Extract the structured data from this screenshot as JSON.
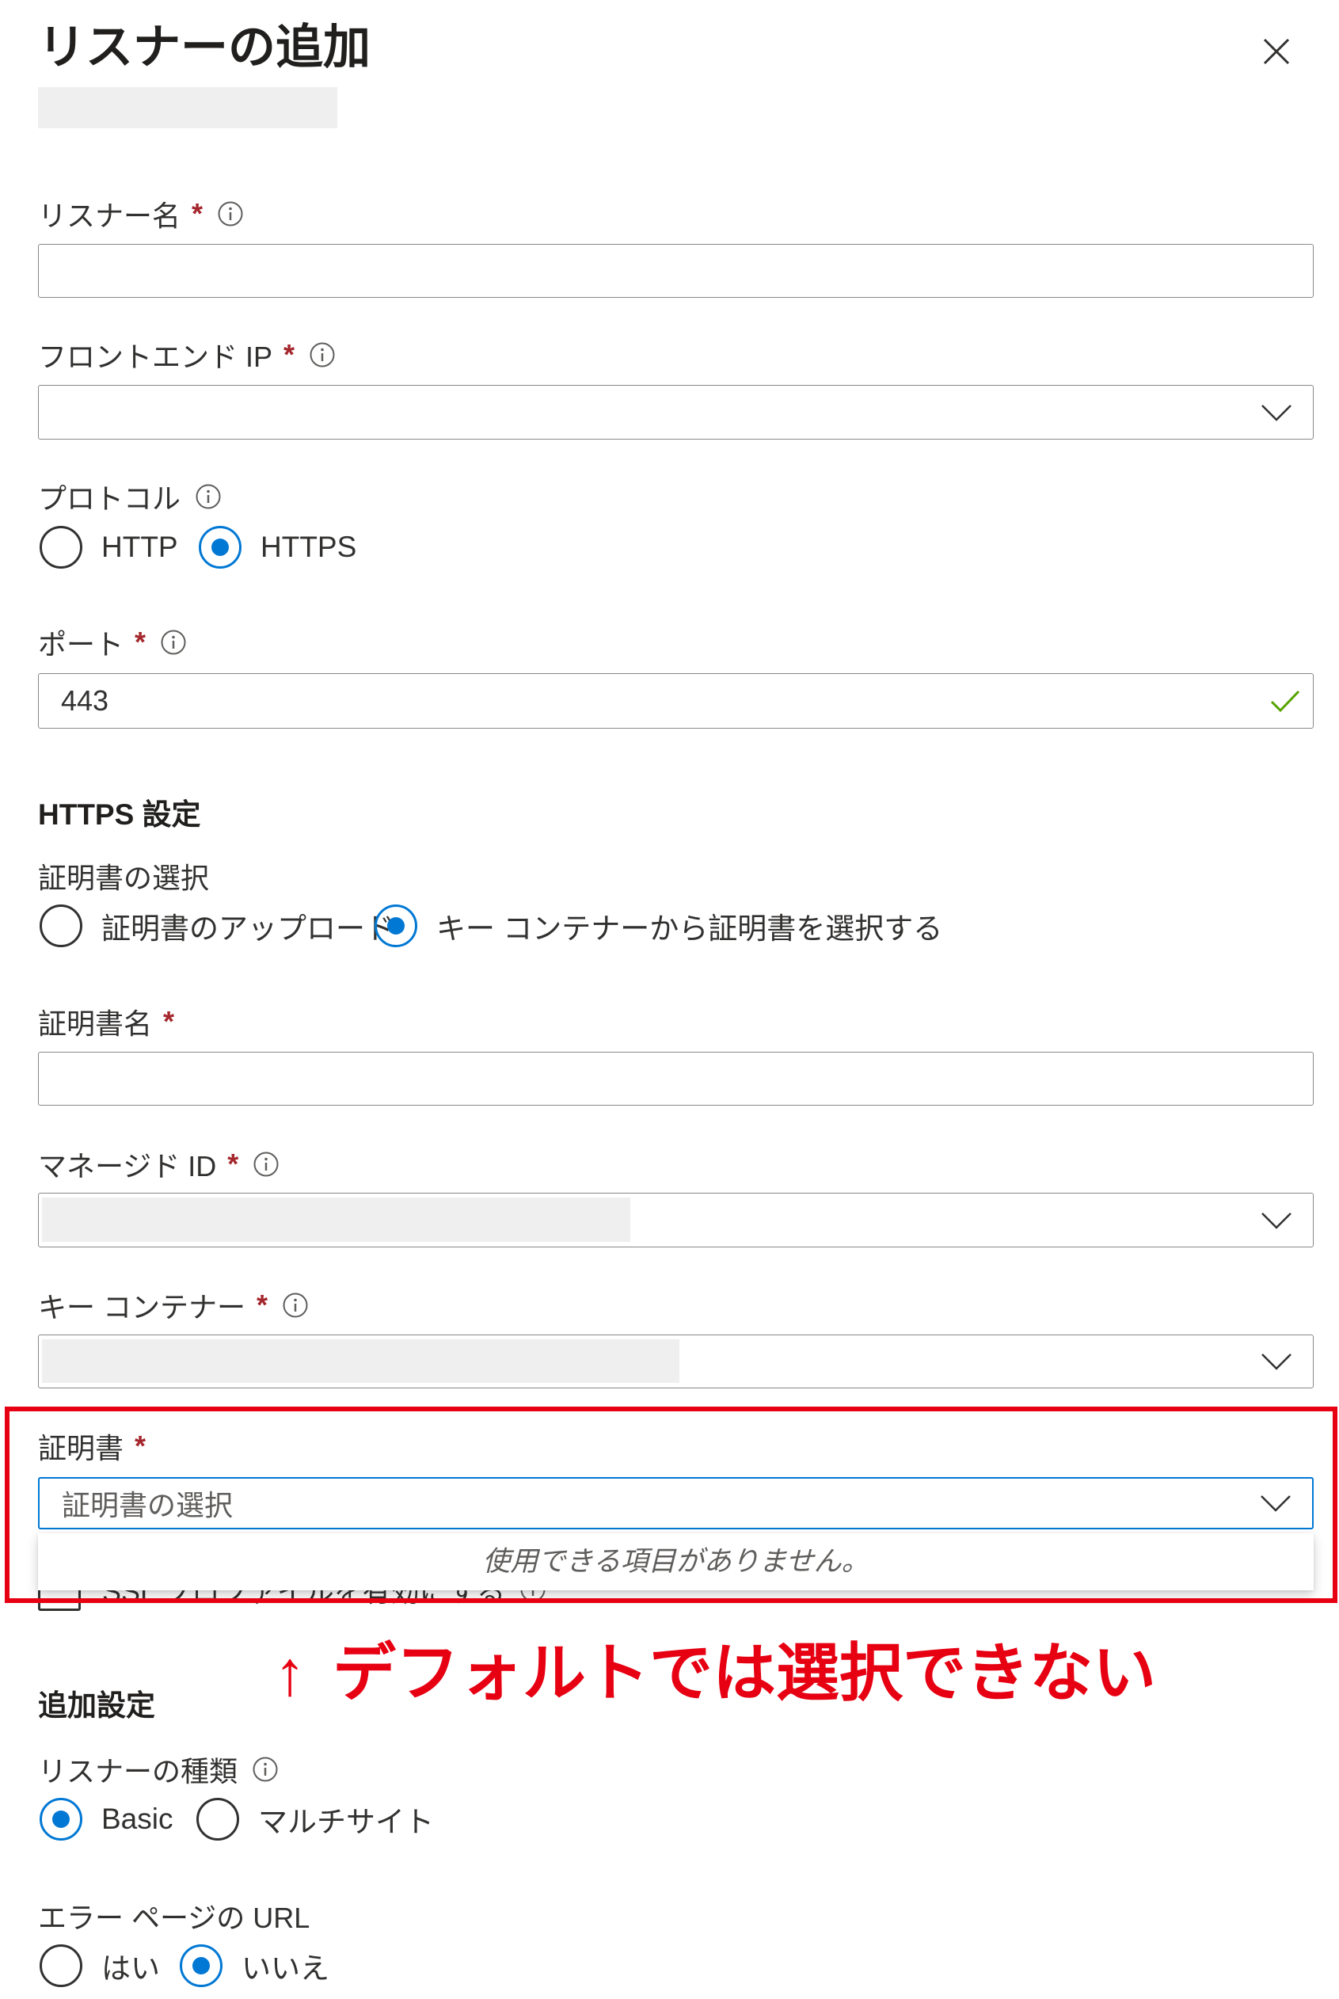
{
  "panel": {
    "title": "リスナーの追加"
  },
  "icons": {
    "close": "close-icon",
    "info": "info-icon",
    "chevron": "chevron-down-icon",
    "check": "checkmark-icon",
    "arrow": "up-arrow"
  },
  "colors": {
    "accent": "#0078d4",
    "required": "#a4262c",
    "valid_check": "#57a300",
    "annotation": "#e60012",
    "text": "#323130"
  },
  "required_mark": "*",
  "basic": {
    "listener_name": {
      "label": "リスナー名",
      "value": ""
    },
    "frontend_ip": {
      "label": "フロントエンド IP",
      "value": ""
    },
    "protocol": {
      "label": "プロトコル",
      "options": [
        "HTTP",
        "HTTPS"
      ],
      "selected": "HTTPS"
    },
    "port": {
      "label": "ポート",
      "value": "443"
    }
  },
  "https_settings": {
    "heading": "HTTPS 設定",
    "certificate_source": {
      "label": "証明書の選択",
      "options": [
        "証明書のアップロード",
        "キー コンテナーから証明書を選択する"
      ],
      "selected": "キー コンテナーから証明書を選択する"
    },
    "certificate_name": {
      "label": "証明書名",
      "value": ""
    },
    "managed_id": {
      "label": "マネージド ID"
    },
    "key_vault": {
      "label": "キー コンテナー"
    },
    "certificate": {
      "label": "証明書",
      "placeholder": "証明書の選択",
      "dropdown_message": "使用できる項目がありません。"
    },
    "ssl_profile": {
      "label": "SSL プロファイルを有効にする",
      "checked": false
    }
  },
  "annotation": {
    "arrow": "↑",
    "text": "デフォルトでは選択できない"
  },
  "additional_settings": {
    "heading": "追加設定",
    "listener_type": {
      "label": "リスナーの種類",
      "options": [
        "Basic",
        "マルチサイト"
      ],
      "selected": "Basic"
    },
    "error_page_url": {
      "label": "エラー ページの URL",
      "options": [
        "はい",
        "いいえ"
      ],
      "selected": "いいえ"
    }
  }
}
